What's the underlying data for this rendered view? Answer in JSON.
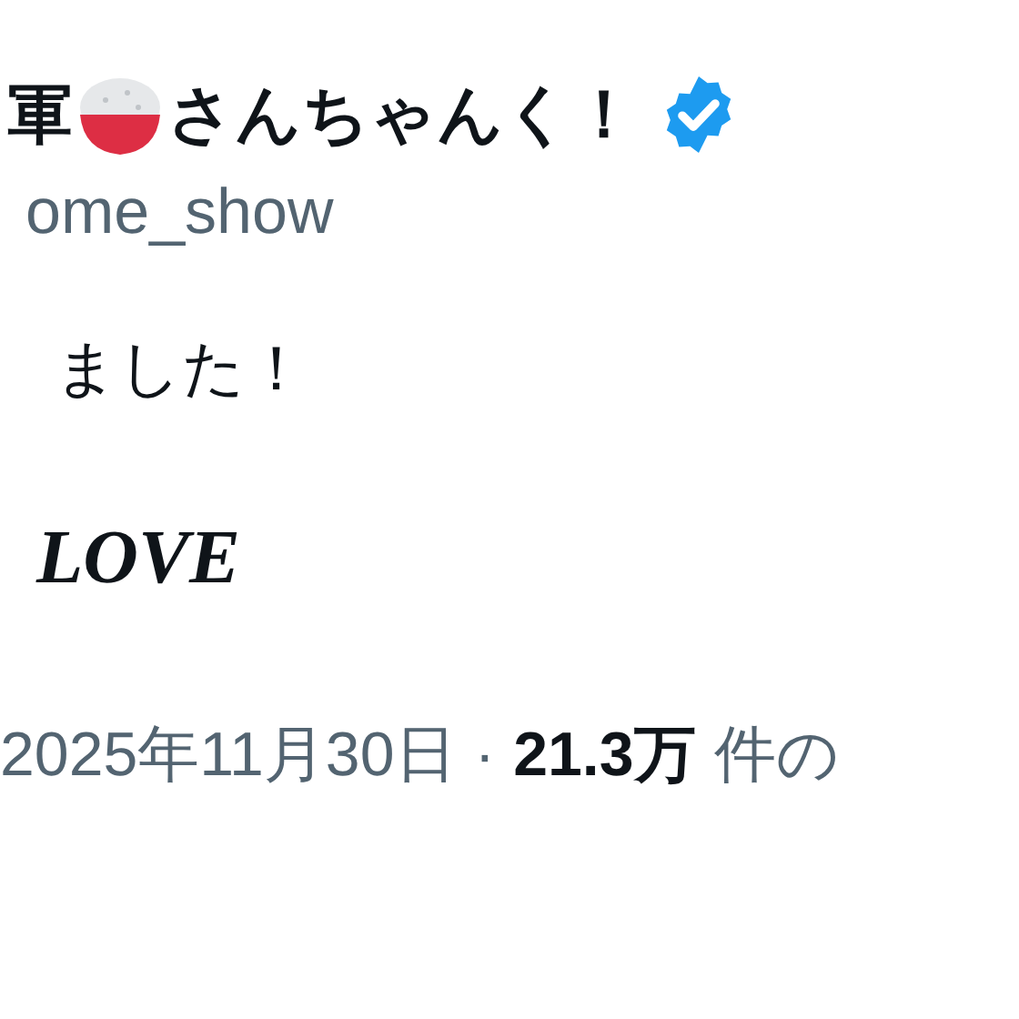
{
  "author": {
    "name_start": "軍",
    "name_end": "さんちゃんく！",
    "verified": true,
    "handle": "ome_show"
  },
  "body": {
    "line": "ました！",
    "tag": "LOVE"
  },
  "meta": {
    "date": "2025年11月30日",
    "separator": "·",
    "views": "21.3万",
    "views_label": "件の"
  }
}
